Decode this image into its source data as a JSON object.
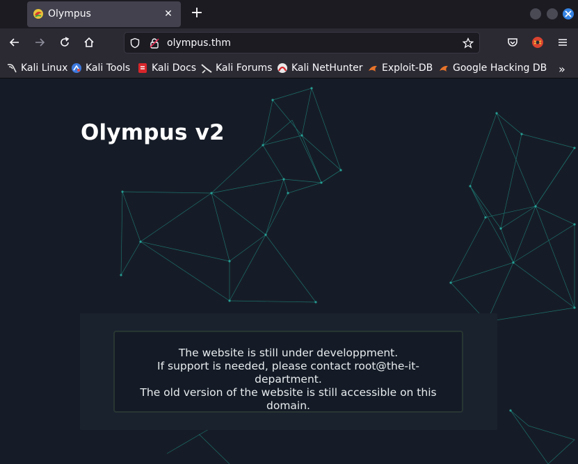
{
  "browser": {
    "tab": {
      "title": "Olympus",
      "favicon": "olympus-favicon"
    },
    "new_tab_symbol": "+",
    "url": "olympus.thm",
    "bookmarks": [
      {
        "label": "Kali Linux",
        "icon": "kali-dragon-icon"
      },
      {
        "label": "Kali Tools",
        "icon": "kali-tools-icon"
      },
      {
        "label": "Kali Docs",
        "icon": "kali-docs-icon"
      },
      {
        "label": "Kali Forums",
        "icon": "kali-forums-icon"
      },
      {
        "label": "Kali NetHunter",
        "icon": "kali-nethunter-icon"
      },
      {
        "label": "Exploit-DB",
        "icon": "exploit-db-icon"
      },
      {
        "label": "Google Hacking DB",
        "icon": "ghdb-icon"
      }
    ],
    "colors": {
      "accent": "#3584e4",
      "tab_active": "#42414d",
      "toolbar": "#2b2a33"
    }
  },
  "page": {
    "title": "Olympus v2",
    "message": {
      "line1": "The website is still under developpment.",
      "line2": "If support is needed, please contact root@the-it-department.",
      "line3": "The old version of the website is still accessible on this domain."
    },
    "colors": {
      "background": "#161c27",
      "mesh": "#1e8c82",
      "panel": "#1a222e"
    }
  }
}
